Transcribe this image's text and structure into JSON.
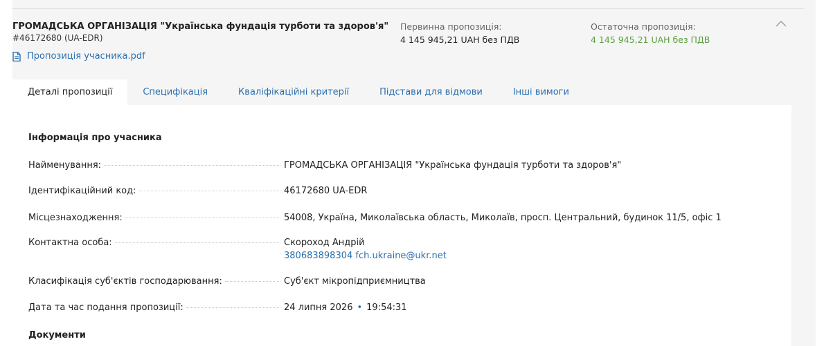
{
  "bidder": {
    "name": "ГРОМАДСЬКА ОРГАНІЗАЦІЯ \"Українська фундація турботи та здоров'я\"",
    "id": "#46172680 (UA-EDR)",
    "file_name": "Пропозиція учасника.pdf"
  },
  "prices": {
    "initial_label": "Первинна пропозиція:",
    "initial_value": "4 145 945,21 UAH без ПДВ",
    "final_label": "Остаточна пропозиція:",
    "final_value": "4 145 945,21 UAH без ПДВ"
  },
  "colors": {
    "link": "#2a6fb0",
    "final_price": "#5a9f3e",
    "page_background": "#f5f5f5"
  },
  "icons": {
    "file": "file-icon",
    "collapse": "chevron-up-icon"
  },
  "tabs": [
    {
      "label": "Деталі пропозиції",
      "active": true
    },
    {
      "label": "Специфікація",
      "active": false
    },
    {
      "label": "Кваліфікаційні критерії",
      "active": false
    },
    {
      "label": "Підстави для відмови",
      "active": false
    },
    {
      "label": "Інші вимоги",
      "active": false
    }
  ],
  "details": {
    "section_title": "Інформація про учасника",
    "rows": [
      {
        "label": "Найменування:",
        "value": "ГРОМАДСЬКА ОРГАНІЗАЦІЯ \"Українська фундація турботи та здоров'я\""
      },
      {
        "label": "Ідентифікаційний код:",
        "value": "46172680 UA-EDR"
      },
      {
        "label": "Місцезнаходження:",
        "value": "54008, Україна, Миколаївська область, Миколаїв, просп. Центральний, будинок 11/5, офіс 1"
      },
      {
        "label": "Контактна особа:",
        "value": "Скороход Андрій",
        "phone": "380683898304",
        "email": "fch.ukraine@ukr.net"
      },
      {
        "label": "Класифікація суб'єктів господарювання:",
        "value": "Суб'єкт мікропідприємництва"
      },
      {
        "label": "Дата та час подання пропозиції:",
        "date": "24 липня 2026",
        "separator": "•",
        "time": "19:54:31"
      }
    ],
    "documents_title": "Документи"
  }
}
